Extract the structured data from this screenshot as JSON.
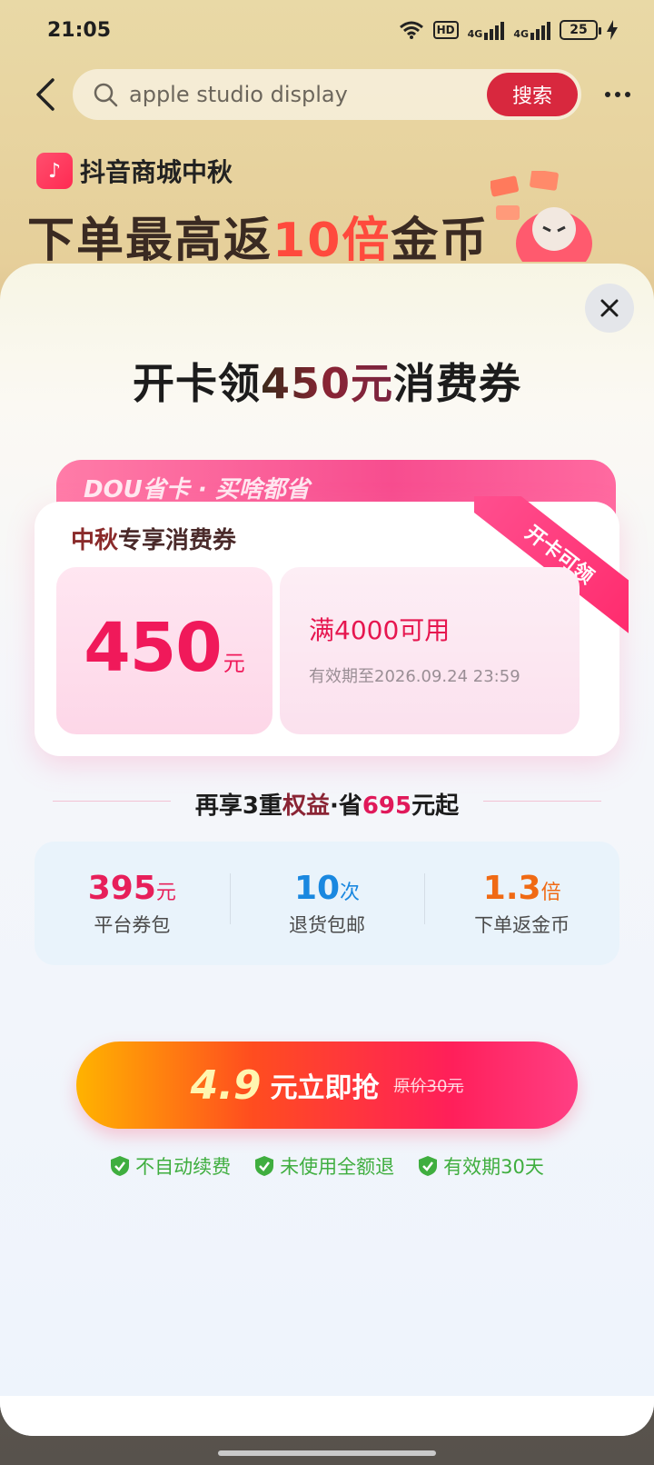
{
  "status_bar": {
    "time": "21:05",
    "hd_label": "HD",
    "net1": "4G",
    "net2": "4G",
    "battery": "25"
  },
  "search": {
    "query": "apple studio display",
    "button_label": "搜索"
  },
  "promo": {
    "brand": "抖音商城中秋",
    "headline_pre": "下单最高返",
    "headline_hl": "10倍",
    "headline_post": "金币"
  },
  "modal": {
    "title_pre": "开卡领",
    "title_hl": "450元",
    "title_post": "消费券",
    "card": {
      "tab_text": "DOU省卡 · 买啥都省",
      "label_hl": "中秋",
      "label_rest": "专享消费券",
      "ribbon": "开卡可领",
      "amount": "450",
      "unit": "元",
      "condition": "满4000可用",
      "expiry": "有效期至2026.09.24 23:59"
    },
    "extra": {
      "pre": "再享3重",
      "hl1": "权益",
      "mid": "·省",
      "hl2": "695",
      "post": "元起"
    },
    "benefits": [
      {
        "value": "395",
        "unit": "元",
        "label": "平台券包",
        "color": "#e71f5a"
      },
      {
        "value": "10",
        "unit": "次",
        "label": "退货包邮",
        "color": "#1a88e0"
      },
      {
        "value": "1.3",
        "unit": "倍",
        "label": "下单返金币",
        "color": "#f06a14"
      }
    ],
    "cta": {
      "price": "4.9",
      "label": "元立即抢",
      "original": "原价30元"
    },
    "guarantees": [
      "不自动续费",
      "未使用全额退",
      "有效期30天"
    ]
  }
}
